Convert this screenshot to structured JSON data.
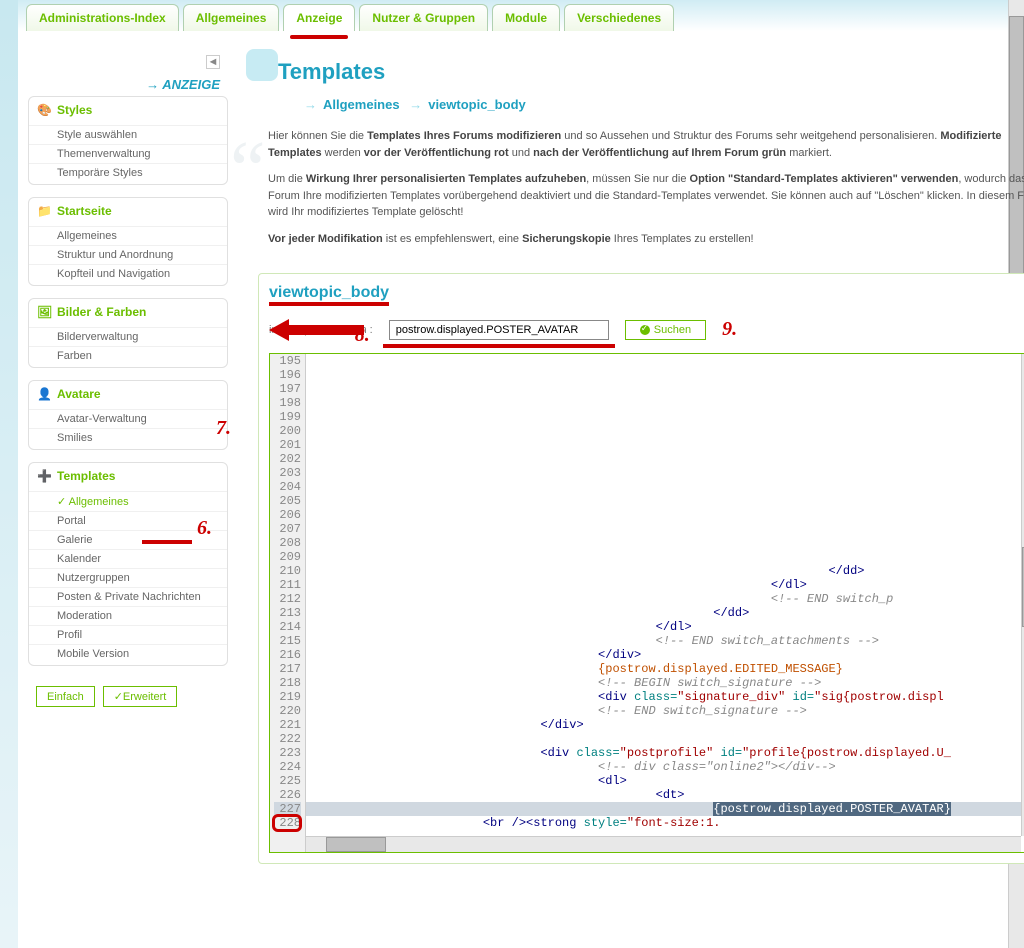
{
  "tabs": [
    "Administrations-Index",
    "Allgemeines",
    "Anzeige",
    "Nutzer & Gruppen",
    "Module",
    "Verschiedenes"
  ],
  "activeTab": 2,
  "sidebar": {
    "heading": "ANZEIGE",
    "sections": [
      {
        "title": "Styles",
        "icon": "palette",
        "items": [
          "Style auswählen",
          "Themenverwaltung",
          "Temporäre Styles"
        ]
      },
      {
        "title": "Startseite",
        "icon": "home",
        "items": [
          "Allgemeines",
          "Struktur und Anordnung",
          "Kopfteil und Navigation"
        ]
      },
      {
        "title": "Bilder & Farben",
        "icon": "image",
        "items": [
          "Bilderverwaltung",
          "Farben"
        ]
      },
      {
        "title": "Avatare",
        "icon": "avatar",
        "items": [
          "Avatar-Verwaltung",
          "Smilies"
        ]
      },
      {
        "title": "Templates",
        "icon": "plus",
        "items": [
          "Allgemeines",
          "Portal",
          "Galerie",
          "Kalender",
          "Nutzergruppen",
          "Posten & Private Nachrichten",
          "Moderation",
          "Profil",
          "Mobile Version"
        ],
        "active": 0
      }
    ],
    "buttons": {
      "simple": "Einfach",
      "advanced": "Erweitert"
    }
  },
  "page": {
    "title": "Templates",
    "breadcrumb": [
      "Allgemeines",
      "viewtopic_body"
    ],
    "info": {
      "p1a": "Hier können Sie die ",
      "p1b": "Templates Ihres Forums modifizieren",
      "p1c": " und so Aussehen und Struktur des Forums sehr weitgehend personalisieren. ",
      "p1d": "Modifizierte Templates",
      "p1e": " werden ",
      "p1f": "vor der Veröffentlichung rot",
      "p1g": " und ",
      "p1h": "nach der Veröffentlichung auf Ihrem Forum grün",
      "p1i": " markiert.",
      "p2a": "Um die ",
      "p2b": "Wirkung Ihrer personalisierten Templates aufzuheben",
      "p2c": ", müssen Sie nur die ",
      "p2d": "Option \"Standard-Templates aktivieren\" verwenden",
      "p2e": ", wodurch das Forum Ihre modifizierten Templates vorübergehend deaktiviert und die Standard-Templates verwendet. Sie können auch auf \"Löschen\" klicken. In diesem Fall wird Ihr modifiziertes Template gelöscht!",
      "p3a": "Vor jeder Modifikation",
      "p3b": " ist es empfehlenswert, eine ",
      "p3c": "Sicherungskopie",
      "p3d": " Ihres Templates zu erstellen!"
    }
  },
  "editor": {
    "title": "viewtopic_body",
    "searchLabel": "im Template suchen :",
    "searchValue": "postrow.displayed.POSTER_AVATAR",
    "searchButton": "Suchen",
    "lines": [
      195,
      196,
      197,
      198,
      199,
      200,
      201,
      202,
      203,
      204,
      205,
      206,
      207,
      208,
      209,
      210,
      211,
      212,
      213,
      214,
      215,
      216,
      217,
      218,
      219,
      220,
      221,
      222,
      223,
      224,
      225,
      226,
      227,
      228
    ]
  },
  "annotations": {
    "a6": "6.",
    "a7": "7.",
    "a8": "8.",
    "a9": "9."
  }
}
